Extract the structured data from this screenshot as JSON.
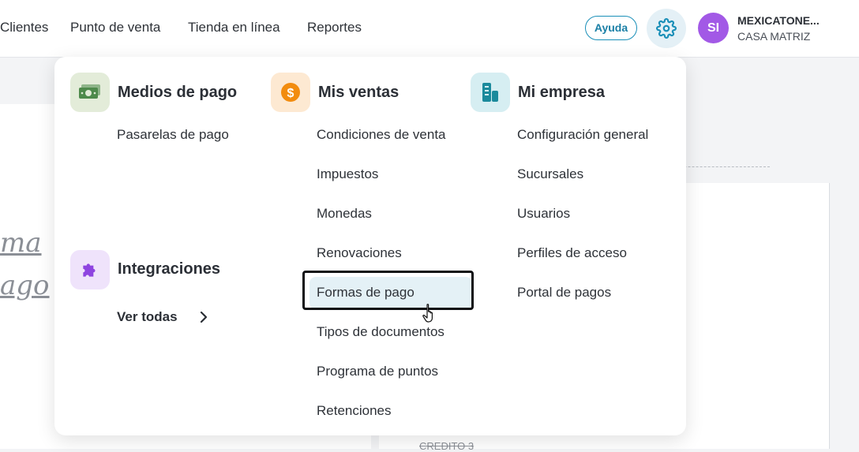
{
  "topnav": {
    "items": [
      "Clientes",
      "Punto de venta",
      "Tienda en línea",
      "Reportes"
    ],
    "help_label": "Ayuda",
    "settings_icon": "gear-icon",
    "avatar_initials": "SI",
    "company_name": "MEXICATONE...",
    "company_branch": "CASA MATRIZ"
  },
  "background": {
    "script_line_1": "ma",
    "script_line_2": "ago",
    "credit_label": "CREDITO 3"
  },
  "menu": {
    "medios_de_pago": {
      "title": "Medios de pago",
      "icon": "money-icon",
      "items": [
        "Pasarelas de pago"
      ]
    },
    "integraciones": {
      "title": "Integraciones",
      "icon": "puzzle-icon",
      "link": "Ver todas"
    },
    "mis_ventas": {
      "title": "Mis ventas",
      "icon": "dollar-coin-icon",
      "items": [
        "Condiciones de venta",
        "Impuestos",
        "Monedas",
        "Renovaciones",
        "Formas de pago",
        "Tipos de documentos",
        "Programa de puntos",
        "Retenciones"
      ],
      "selected": "Formas de pago"
    },
    "mi_empresa": {
      "title": "Mi empresa",
      "icon": "building-icon",
      "items": [
        "Configuración general",
        "Sucursales",
        "Usuarios",
        "Perfiles de acceso",
        "Portal de pagos"
      ]
    }
  },
  "colors": {
    "accent": "#1a8fb8",
    "avatar": "#a259e6",
    "money_icon_bg": "#e3ecd9",
    "dollar_icon_bg": "#fde9d2",
    "building_icon_bg": "#d6eef2",
    "puzzle_icon_bg": "#efe3fb"
  }
}
